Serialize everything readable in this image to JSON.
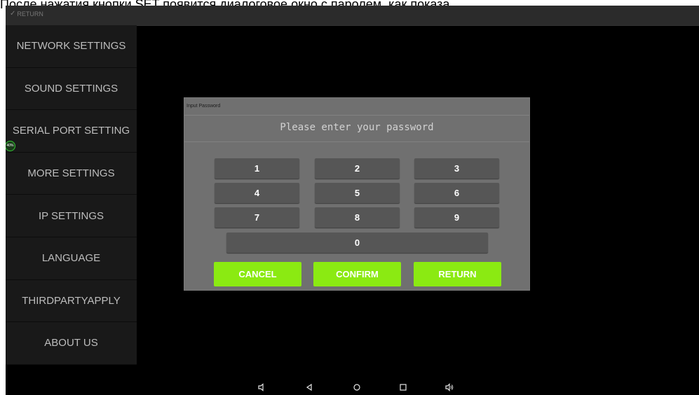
{
  "caption": "После нажатия кнопки SET появится диалоговое окно с паролем, как показа",
  "topbar": {
    "return_label": "RETURN",
    "return_icon": "check-icon"
  },
  "sidebar": {
    "items": [
      {
        "label": "NETWORK SETTINGS"
      },
      {
        "label": "SOUND SETTINGS"
      },
      {
        "label": "SERIAL PORT SETTING"
      },
      {
        "label": "MORE SETTINGS"
      },
      {
        "label": "IP SETTINGS"
      },
      {
        "label": "LANGUAGE"
      },
      {
        "label": "THIRDPARTYAPPLY"
      },
      {
        "label": "ABOUT US"
      }
    ],
    "badge": "40%",
    "badge_progress": 0.4
  },
  "dialog": {
    "title": "Input Password",
    "prompt": "Please enter your password",
    "keys": [
      "1",
      "2",
      "3",
      "4",
      "5",
      "6",
      "7",
      "8",
      "9",
      "0"
    ],
    "cancel_label": "CANCEL",
    "confirm_label": "CONFIRM",
    "return_label": "RETURN",
    "accent_color": "#8bea12"
  },
  "navbar": {
    "icons": [
      "volume-down-icon",
      "back-icon",
      "home-icon",
      "recents-icon",
      "volume-up-icon"
    ]
  }
}
